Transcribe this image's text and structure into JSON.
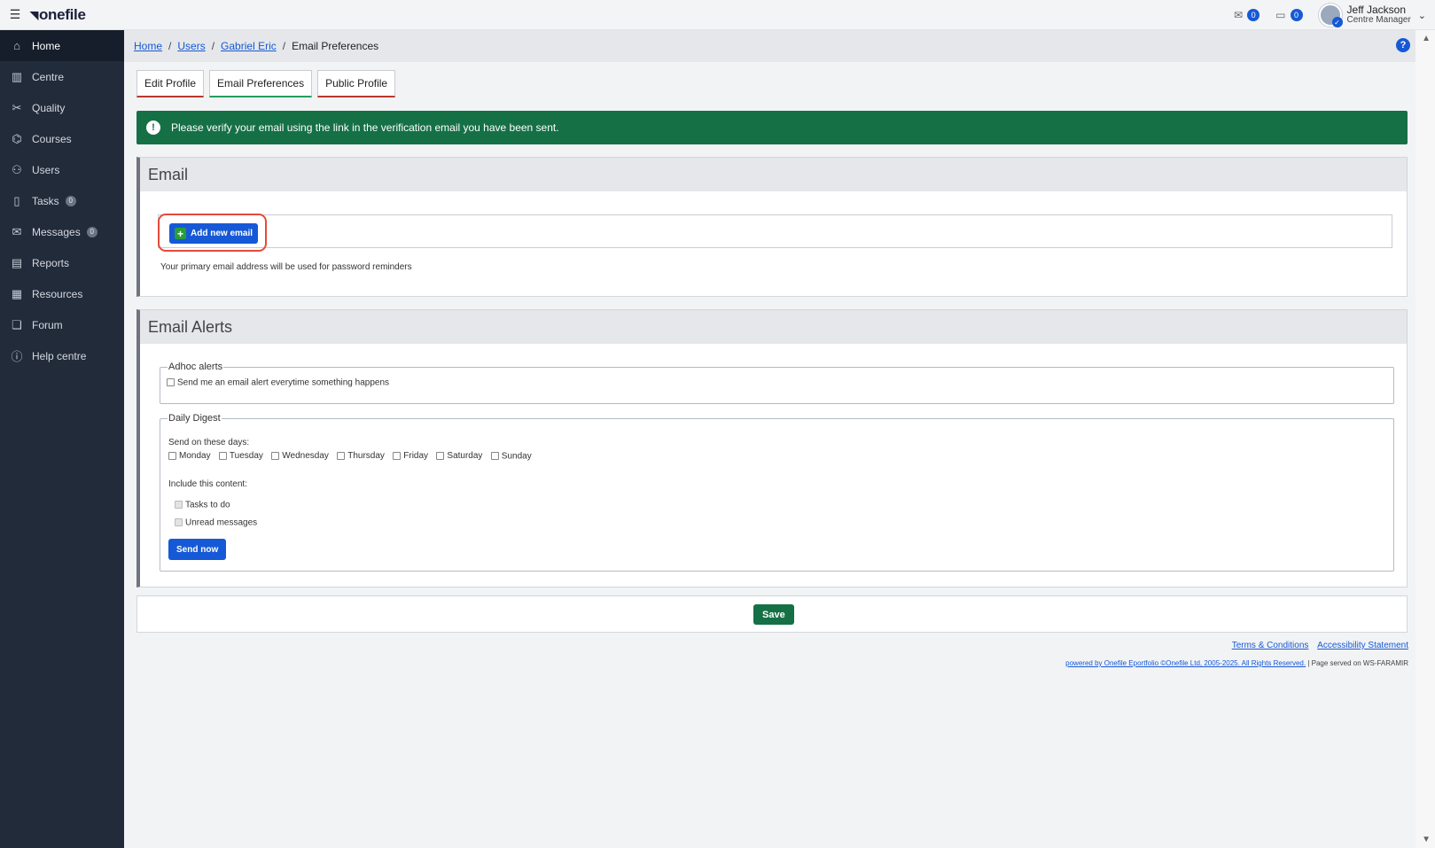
{
  "app": {
    "logo_text": "onefile"
  },
  "topbar": {
    "messages_count": "0",
    "tasks_count": "0",
    "user_name": "Jeff Jackson",
    "user_role": "Centre Manager"
  },
  "sidebar": {
    "items": [
      {
        "label": "Home",
        "icon": "home-icon",
        "active": true
      },
      {
        "label": "Centre",
        "icon": "building-icon"
      },
      {
        "label": "Quality",
        "icon": "tools-icon"
      },
      {
        "label": "Courses",
        "icon": "graduation-cap-icon"
      },
      {
        "label": "Users",
        "icon": "users-icon"
      },
      {
        "label": "Tasks",
        "icon": "clipboard-icon",
        "badge": "0"
      },
      {
        "label": "Messages",
        "icon": "envelope-icon",
        "badge": "0"
      },
      {
        "label": "Reports",
        "icon": "report-icon"
      },
      {
        "label": "Resources",
        "icon": "resources-icon"
      },
      {
        "label": "Forum",
        "icon": "forum-icon"
      },
      {
        "label": "Help centre",
        "icon": "help-circle-icon"
      }
    ]
  },
  "breadcrumb": {
    "home": "Home",
    "users": "Users",
    "person": "Gabriel Eric",
    "current": "Email Preferences",
    "sep": "/"
  },
  "tabs": [
    {
      "label": "Edit Profile"
    },
    {
      "label": "Email Preferences",
      "active": true
    },
    {
      "label": "Public Profile"
    }
  ],
  "alert": {
    "text": "Please verify your email using the link in the verification email you have been sent."
  },
  "email_panel": {
    "title": "Email",
    "add_button": "Add new email",
    "note": "Your primary email address will be used for password reminders"
  },
  "alerts_panel": {
    "title": "Email Alerts",
    "adhoc_legend": "Adhoc alerts",
    "adhoc_option": "Send me an email alert everytime something happens",
    "digest_legend": "Daily Digest",
    "days_label": "Send on these days:",
    "days": [
      "Monday",
      "Tuesday",
      "Wednesday",
      "Thursday",
      "Friday",
      "Saturday",
      "Sunday"
    ],
    "content_label": "Include this content:",
    "content_options": [
      "Tasks to do",
      "Unread messages"
    ],
    "send_now": "Send now"
  },
  "save_label": "Save",
  "footer": {
    "terms": "Terms & Conditions",
    "accessibility": "Accessibility Statement",
    "powered": "powered by Onefile Eportfolio ©Onefile Ltd, 2005-2025. All Rights Reserved.",
    "served": "| Page served on WS-FARAMIR"
  },
  "colors": {
    "sidebar_bg": "#222b3a",
    "accent_blue": "#1659d6",
    "success_green": "#157046",
    "highlight_red": "#e44a3d"
  }
}
